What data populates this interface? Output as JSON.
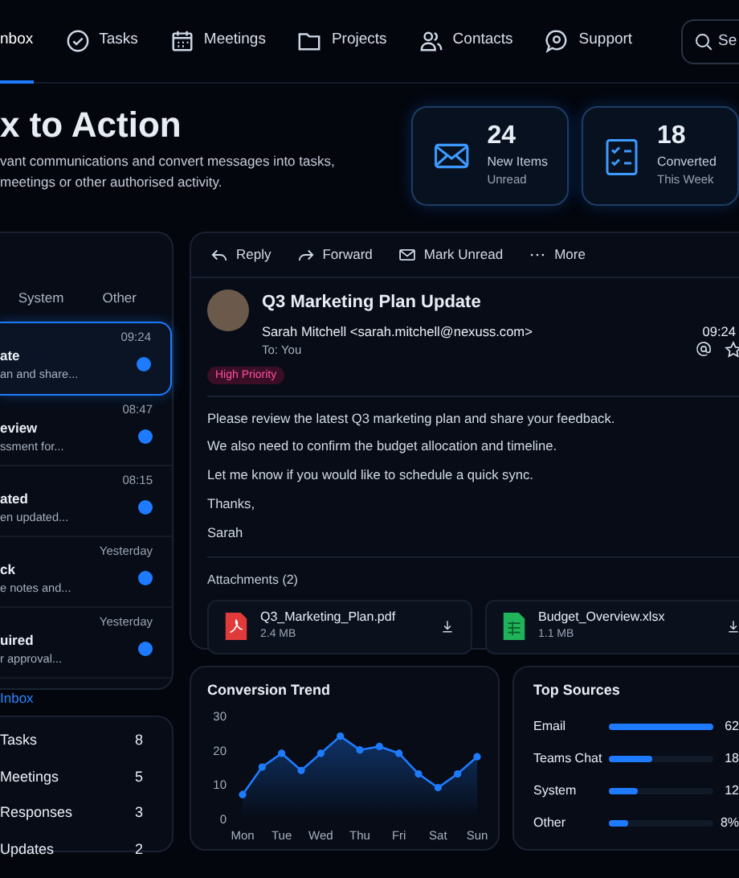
{
  "nav": {
    "items": [
      {
        "label": "nbox",
        "selected": true
      },
      {
        "label": "Tasks",
        "selected": false
      },
      {
        "label": "Meetings",
        "selected": false
      },
      {
        "label": "Projects",
        "selected": false
      },
      {
        "label": "Contacts",
        "selected": false
      },
      {
        "label": "Support",
        "selected": false
      }
    ],
    "search": {
      "placeholder": "Se"
    }
  },
  "hero": {
    "title": "x to Action",
    "lines": [
      "vant communications and convert messages into tasks,",
      "meetings or other authorised activity."
    ]
  },
  "stats": [
    {
      "value": "24",
      "label": "New Items",
      "sublabel": "Unread"
    },
    {
      "value": "18",
      "label": "Converted",
      "sublabel": "This Week"
    }
  ],
  "inbox": {
    "tabs": [
      {
        "label": "System",
        "selected": false
      },
      {
        "label": "Other",
        "selected": false
      }
    ],
    "messages": [
      {
        "title": "ate",
        "preview": "an and share...",
        "time": "09:24",
        "unread": true,
        "selected": true
      },
      {
        "title": "eview",
        "preview": "ssment for...",
        "time": "08:47",
        "unread": true,
        "selected": false
      },
      {
        "title": "ated",
        "preview": "en updated...",
        "time": "08:15",
        "unread": true,
        "selected": false
      },
      {
        "title": "ck",
        "preview": "e notes and...",
        "time": "Yesterday",
        "unread": true,
        "selected": false
      },
      {
        "title": "uired",
        "preview": "r approval...",
        "time": "Yesterday",
        "unread": true,
        "selected": false
      }
    ],
    "footer_link": "Inbox"
  },
  "counts": [
    {
      "label": "Tasks",
      "count": "8"
    },
    {
      "label": "Meetings",
      "count": "5"
    },
    {
      "label": "Responses",
      "count": "3"
    },
    {
      "label": "Updates",
      "count": "2"
    }
  ],
  "email": {
    "toolbar": [
      "Reply",
      "Forward",
      "Mark Unread",
      "More"
    ],
    "subject": "Q3 Marketing Plan Update",
    "from": "Sarah Mitchell <sarah.mitchell@nexuss.com>",
    "time": "09:24",
    "to": "To: You",
    "badge": "High Priority",
    "body": [
      "Please review the latest Q3 marketing plan and share your feedback.",
      "We also need to confirm the budget allocation and timeline.",
      "Let me know if you would like to schedule a quick sync.",
      "Thanks,",
      "Sarah"
    ],
    "attachments_label": "Attachments (2)",
    "attachments": [
      {
        "kind": "pdf",
        "name": "Q3_Marketing_Plan.pdf",
        "size": "2.4 MB"
      },
      {
        "kind": "sheet",
        "name": "Budget_Overview.xlsx",
        "size": "1.1 MB"
      }
    ]
  },
  "trend": {
    "title": "Conversion Trend",
    "chart_data": {
      "type": "area",
      "categories": [
        "Mon",
        null,
        "Tue",
        null,
        "Wed",
        null,
        "Thu",
        null,
        "Fri",
        null,
        "Sat",
        null,
        "Sun"
      ],
      "series": [
        {
          "color": "#1e7bff",
          "values": [
            7,
            15,
            19,
            14,
            19,
            24,
            20,
            21,
            19,
            13,
            9,
            13,
            18
          ]
        }
      ],
      "ylim": [
        0,
        30
      ],
      "yticks": [
        0,
        10,
        20,
        30
      ]
    }
  },
  "sources": {
    "title": "Top Sources",
    "items": [
      {
        "label": "Email",
        "level": 1.0,
        "value": "62"
      },
      {
        "label": "Teams Chat",
        "level": 0.42,
        "value": "18"
      },
      {
        "label": "System",
        "level": 0.28,
        "value": "12"
      },
      {
        "label": "Other",
        "level": 0.18,
        "value": "8%"
      }
    ]
  }
}
